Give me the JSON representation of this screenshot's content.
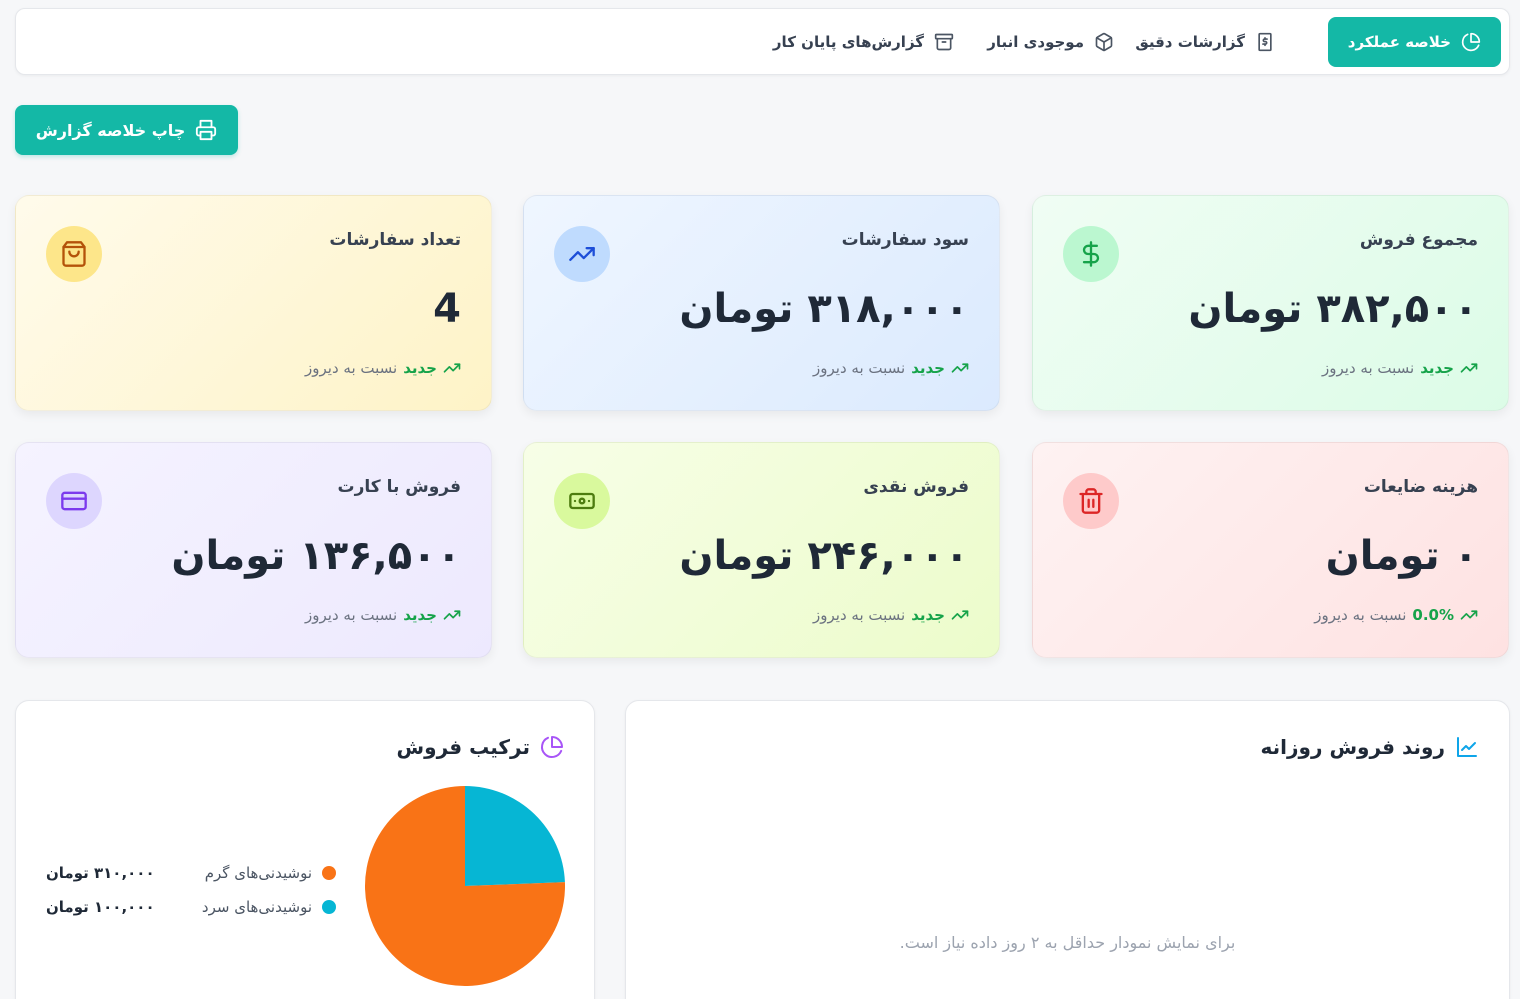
{
  "nav": {
    "tabs": [
      {
        "label": "خلاصه عملکرد",
        "icon": "pie-chart-icon",
        "active": true
      },
      {
        "label": "گزارشات دقیق",
        "icon": "receipt-icon",
        "active": false
      },
      {
        "label": "موجودی انبار",
        "icon": "package-icon",
        "active": false
      },
      {
        "label": "گزارش‌های پایان کار",
        "icon": "archive-icon",
        "active": false
      }
    ]
  },
  "print_button": {
    "label": "چاپ خلاصه گزارش",
    "icon": "printer-icon"
  },
  "stats": {
    "total_sales": {
      "title": "مجموع فروش",
      "value": "۳۸۲,۵۰۰ تومان",
      "change": "جدید",
      "suffix": "نسبت به دیروز",
      "icon": "dollar-icon"
    },
    "profit": {
      "title": "سود سفارشات",
      "value": "۳۱۸,۰۰۰ تومان",
      "change": "جدید",
      "suffix": "نسبت به دیروز",
      "icon": "trending-up-icon"
    },
    "orders": {
      "title": "تعداد سفارشات",
      "value": "4",
      "change": "جدید",
      "suffix": "نسبت به دیروز",
      "icon": "shopping-bag-icon"
    },
    "waste": {
      "title": "هزینه ضایعات",
      "value": "۰ تومان",
      "change": "0.0%",
      "suffix": "نسبت به دیروز",
      "icon": "trash-icon"
    },
    "cash": {
      "title": "فروش نقدی",
      "value": "۲۴۶,۰۰۰ تومان",
      "change": "جدید",
      "suffix": "نسبت به دیروز",
      "icon": "banknote-icon"
    },
    "card": {
      "title": "فروش با کارت",
      "value": "۱۳۶,۵۰۰ تومان",
      "change": "جدید",
      "suffix": "نسبت به دیروز",
      "icon": "credit-card-icon"
    }
  },
  "trend_panel": {
    "title": "روند فروش روزانه",
    "icon": "line-chart-icon",
    "empty_message": "برای نمایش نمودار حداقل به ۲ روز داده نیاز است."
  },
  "mix_panel": {
    "title": "ترکیب فروش",
    "icon": "pie-chart-icon"
  },
  "colors": {
    "accent": "#14b8a6",
    "hot": "#f97316",
    "cold": "#06b6d4",
    "positive": "#16a34a"
  },
  "chart_data": {
    "type": "pie",
    "categories": [
      "نوشیدنی‌های گرم",
      "نوشیدنی‌های سرد"
    ],
    "values": [
      310000,
      100000
    ],
    "value_labels": [
      "۳۱۰,۰۰۰ تومان",
      "۱۰۰,۰۰۰ تومان"
    ],
    "colors": [
      "#f97316",
      "#06b6d4"
    ],
    "legend_position": "left"
  }
}
